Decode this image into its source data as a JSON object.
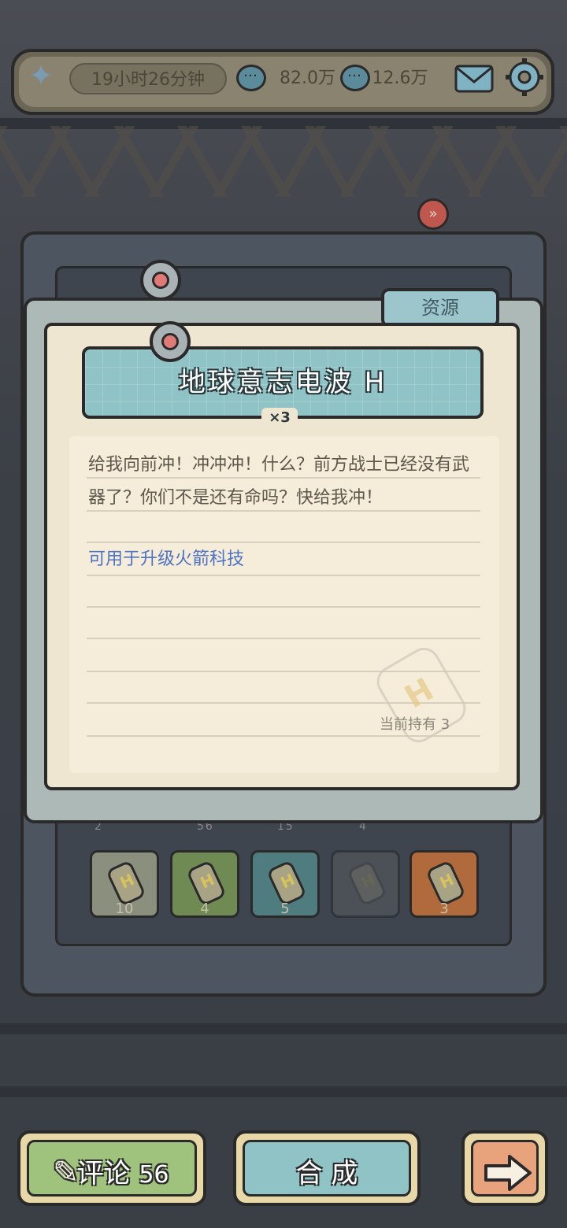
{
  "topbar": {
    "timer": "19小时26分钟",
    "currency1": "82.0万",
    "currency2": "12.6万",
    "icons": [
      "bolt-icon",
      "chat-bubble-icon",
      "chat-bubble-icon",
      "mail-icon",
      "gear-icon"
    ]
  },
  "dialog": {
    "tab_label": "资源",
    "title": "地球意志电波 H",
    "quantity": "×3",
    "description": "给我向前冲！冲冲冲！什么？前方战士已经没有武器了？你们不是还有命吗？快给我冲！",
    "usage": "可用于升级火箭科技",
    "held_label": "当前持有",
    "held_count": "3"
  },
  "slots": {
    "top_row_counts": [
      "2",
      "56",
      "15",
      "4"
    ],
    "items": [
      {
        "count": "10",
        "color": "#8a8f7e"
      },
      {
        "count": "4",
        "color": "#6f8a52"
      },
      {
        "count": "5",
        "color": "#4f7c7e"
      },
      {
        "count": "",
        "color": "#555a5c"
      },
      {
        "count": "3",
        "color": "#b06a3c"
      }
    ]
  },
  "buttons": {
    "comment_label": "评论",
    "comment_count": "56",
    "synthesize_label": "合 成",
    "next_icon": "arrow-right-icon"
  },
  "colors": {
    "accent_teal": "#8fc3c6",
    "paper": "#efe6d2",
    "link_blue": "#4d72c4",
    "comment_green": "#9fc27c",
    "next_orange": "#e9a37c"
  }
}
